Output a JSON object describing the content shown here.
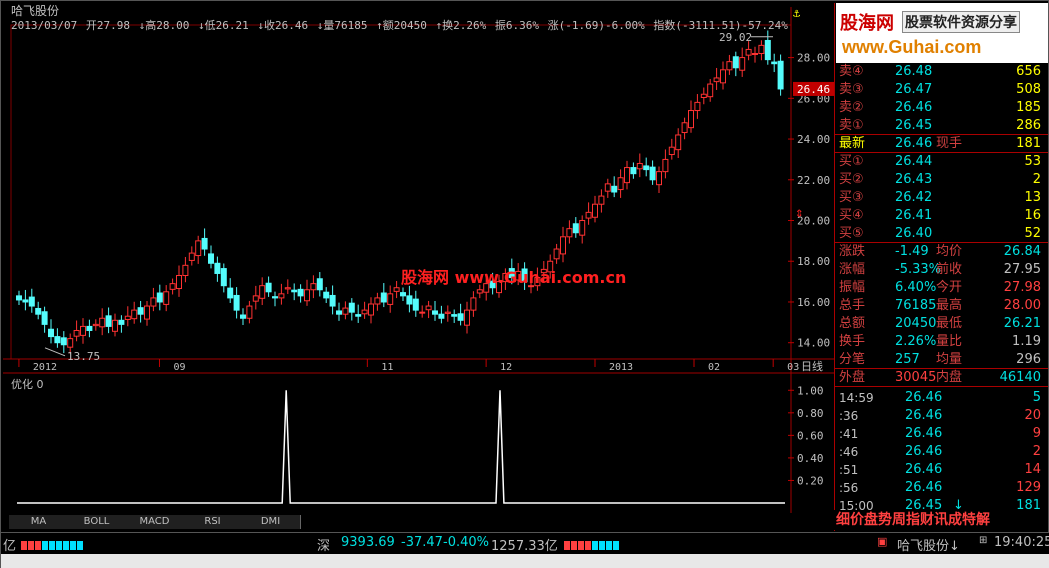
{
  "header": {
    "title": "哈飞股份",
    "date": "2013/03/07",
    "open": "开27.98",
    "high": "↓高28.00",
    "low": "↓低26.21",
    "close": "↓收26.46",
    "volume": "↓量76185",
    "amount": "↑额20450",
    "turnover": "↑换2.26%",
    "amplitude": "振6.36%",
    "change": "涨(-1.69)-6.00%",
    "index": "指数(-3111.51)-57.24%"
  },
  "chart_data": [
    {
      "type": "candlestick",
      "title": "哈飞股份",
      "ylim": [
        13.2,
        29.6
      ],
      "ytick_labels": [
        "14.00",
        "16.00",
        "18.00",
        "20.00",
        "22.00",
        "24.00",
        "26.00",
        "28.00"
      ],
      "yticks": [
        14,
        16,
        18,
        20,
        22,
        24,
        26,
        28
      ],
      "xtick_labels": [
        "2012",
        "09",
        "11",
        "12",
        "2013",
        "02",
        "03"
      ],
      "x_axis_label": "日线",
      "annotations": [
        {
          "text": "29.02",
          "value": 29.02
        },
        {
          "text": "13.75",
          "value": 13.75
        },
        {
          "text": "26.46",
          "value": 26.46
        }
      ],
      "watermark": "股海网 www.Guhai.com.cn",
      "close_series": [
        16.1,
        16.0,
        15.8,
        15.4,
        14.9,
        14.3,
        14.0,
        13.9,
        14.2,
        14.6,
        14.8,
        14.6,
        14.9,
        15.2,
        14.8,
        15.1,
        14.9,
        15.3,
        15.6,
        15.4,
        15.8,
        16.2,
        16.0,
        16.5,
        16.9,
        17.3,
        17.8,
        18.4,
        19.0,
        18.6,
        17.9,
        17.4,
        16.8,
        16.2,
        15.6,
        15.2,
        15.8,
        16.3,
        16.8,
        16.5,
        16.2,
        16.4,
        16.7,
        16.5,
        16.3,
        16.6,
        16.9,
        16.6,
        16.2,
        15.8,
        15.4,
        15.7,
        15.5,
        15.3,
        15.6,
        15.9,
        16.2,
        16.0,
        16.4,
        16.7,
        16.3,
        15.9,
        15.6,
        15.5,
        15.8,
        15.4,
        15.2,
        15.5,
        15.3,
        15.1,
        15.6,
        16.2,
        16.6,
        16.9,
        16.7,
        17.0,
        17.4,
        17.2,
        17.5,
        17.0,
        16.8,
        17.2,
        17.6,
        18.0,
        18.6,
        19.2,
        19.6,
        19.4,
        20.0,
        20.4,
        20.8,
        21.2,
        21.8,
        21.4,
        22.1,
        22.6,
        22.3,
        22.8,
        22.5,
        22.0,
        22.4,
        23.0,
        23.6,
        24.2,
        24.8,
        25.4,
        25.8,
        26.2,
        26.7,
        27.0,
        27.4,
        27.8,
        27.5,
        28.0,
        28.4,
        28.2,
        28.6,
        27.9,
        27.7,
        26.46
      ]
    },
    {
      "type": "line",
      "series": [
        {
          "name": "优化",
          "values": [
            0,
            0,
            0,
            0,
            0,
            0,
            0,
            0,
            0,
            0,
            0,
            0,
            0,
            0,
            0,
            0,
            0,
            0,
            0,
            0,
            0,
            0,
            0,
            0,
            0,
            0,
            0,
            0,
            0,
            0,
            0,
            0,
            0,
            0,
            0,
            0,
            0,
            0,
            0,
            0,
            0,
            0,
            0,
            0,
            0,
            0,
            0,
            0,
            0,
            0,
            0,
            0,
            0,
            0,
            0,
            0,
            0,
            0,
            0,
            0,
            0,
            0,
            0,
            0,
            0,
            0,
            0,
            0,
            1,
            0,
            0,
            0,
            0,
            0,
            0,
            0,
            0,
            0,
            0,
            0,
            0,
            0,
            0,
            0,
            0,
            0,
            0,
            0,
            0,
            0,
            0,
            0,
            0,
            0,
            0,
            0,
            0,
            0,
            0,
            0,
            0,
            0,
            0,
            0,
            0,
            0,
            0,
            0,
            0,
            0,
            0,
            0,
            0,
            0,
            0,
            0,
            0,
            0,
            0,
            0,
            0,
            0,
            1,
            0,
            0,
            0,
            0,
            0,
            0,
            0,
            0,
            0,
            0,
            0,
            0,
            0,
            0,
            0,
            0,
            0,
            0,
            0,
            0,
            0,
            0,
            0,
            0,
            0,
            0,
            0,
            0,
            0,
            0,
            0,
            0,
            0,
            0,
            0,
            0,
            0,
            0,
            0,
            0,
            0,
            0,
            0,
            0,
            0,
            0,
            0,
            0,
            0,
            0,
            0,
            0,
            0,
            0,
            0,
            0,
            0,
            0,
            0,
            0,
            0,
            0,
            0,
            0,
            0,
            0,
            0,
            0,
            0,
            0,
            0,
            0
          ]
        }
      ],
      "title": "优化 0",
      "ylim": [
        0,
        1.1
      ],
      "ytick_labels": [
        "0.20",
        "0.40",
        "0.60",
        "0.80",
        "1.00"
      ],
      "yticks": [
        0.2,
        0.4,
        0.6,
        0.8,
        1.0
      ]
    }
  ],
  "quotes": {
    "sell": [
      {
        "label": "卖④",
        "price": "26.48",
        "vol": "656"
      },
      {
        "label": "卖③",
        "price": "26.47",
        "vol": "508"
      },
      {
        "label": "卖②",
        "price": "26.46",
        "vol": "185"
      },
      {
        "label": "卖①",
        "price": "26.45",
        "vol": "286"
      }
    ],
    "latest": {
      "label": "最新",
      "price": "26.46",
      "label2": "现手",
      "vol": "181"
    },
    "buy": [
      {
        "label": "买①",
        "price": "26.44",
        "vol": "53"
      },
      {
        "label": "买②",
        "price": "26.43",
        "vol": "2"
      },
      {
        "label": "买③",
        "price": "26.42",
        "vol": "13"
      },
      {
        "label": "买④",
        "price": "26.41",
        "vol": "16"
      },
      {
        "label": "买⑤",
        "price": "26.40",
        "vol": "52"
      }
    ],
    "stats": [
      {
        "l1": "涨跌",
        "v1": "-1.49",
        "l2": "均价",
        "v2": "26.84",
        "c2": "#00e0e0"
      },
      {
        "l1": "涨幅",
        "v1": "-5.33%",
        "l2": "前收",
        "v2": "27.95",
        "c2": "#c0c0c0"
      },
      {
        "l1": "振幅",
        "v1": "6.40%",
        "l2": "今开",
        "v2": "27.98",
        "c2": "#ff4040"
      },
      {
        "l1": "总手",
        "v1": "76185",
        "l2": "最高",
        "v2": "28.00",
        "c2": "#ff4040"
      },
      {
        "l1": "总额",
        "v1": "20450",
        "l2": "最低",
        "v2": "26.21",
        "c2": "#00e0e0"
      },
      {
        "l1": "换手",
        "v1": "2.26%",
        "l2": "量比",
        "v2": "1.19",
        "c2": "#c0c0c0"
      },
      {
        "l1": "分笔",
        "v1": "257",
        "l2": "均量",
        "v2": "296",
        "c2": "#c0c0c0"
      }
    ],
    "outer": {
      "label": "外盘",
      "value": "30045",
      "label2": "内盘",
      "value2": "46140"
    }
  },
  "trades": [
    {
      "time": "14:59",
      "price": "26.46",
      "vol": "5",
      "color": "cy"
    },
    {
      "time": ":36",
      "price": "26.46",
      "vol": "20",
      "color": "red"
    },
    {
      "time": ":41",
      "price": "26.46",
      "vol": "9",
      "color": "red"
    },
    {
      "time": ":46",
      "price": "26.46",
      "vol": "2",
      "color": "red"
    },
    {
      "time": ":51",
      "price": "26.46",
      "vol": "14",
      "color": "red"
    },
    {
      "time": ":56",
      "price": "26.46",
      "vol": "129",
      "color": "red"
    },
    {
      "time": "15:00",
      "price": "26.45",
      "vol": "181",
      "color": "cy",
      "arrow": "↓"
    }
  ],
  "right_tabs": "细价盘势周指财讯成特解",
  "logo": {
    "name": "股海网",
    "tagline": "股票软件资源分享",
    "url": "www.Guhai.com"
  },
  "indicator_tabs": [
    "MA",
    "BOLL",
    "MACD",
    "RSI",
    "DMI"
  ],
  "status": {
    "left_unit": "亿",
    "market": "深",
    "index_value": "9393.69",
    "index_change": "-37.47",
    "index_pct": "-0.40%",
    "turnover": "1257.33亿",
    "stock_name": "哈飞股份↓",
    "clock": "19:40:25"
  }
}
